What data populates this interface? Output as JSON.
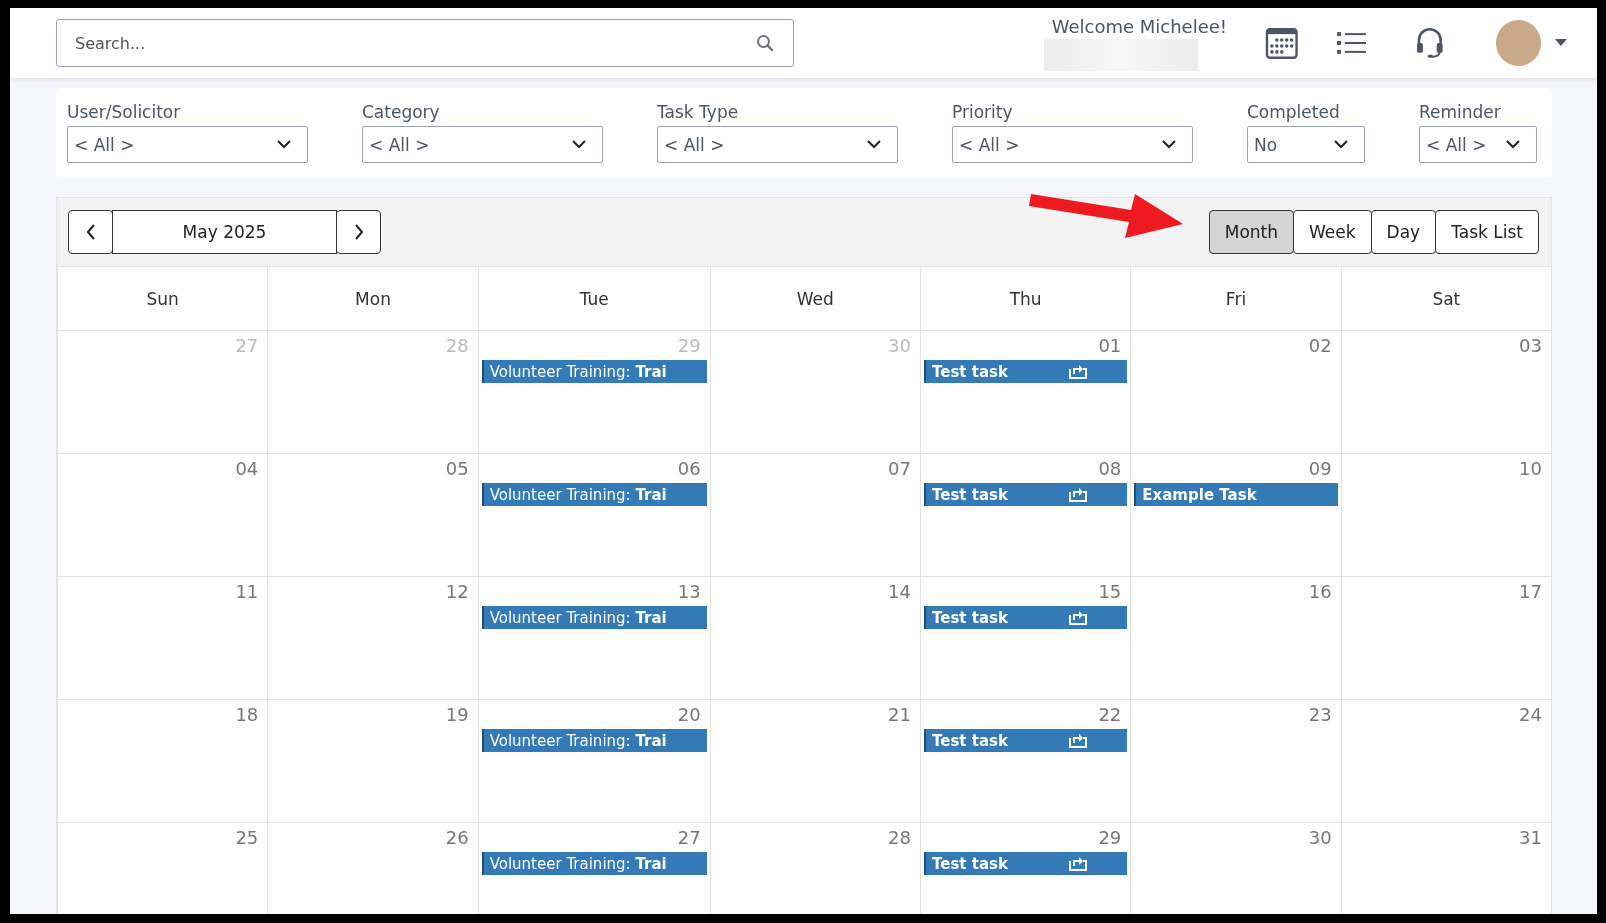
{
  "header": {
    "search": {
      "placeholder": "Search..."
    },
    "welcome": "Welcome Michelee!"
  },
  "filters": [
    {
      "label": "User/Solicitor",
      "value": "< All >"
    },
    {
      "label": "Category",
      "value": "< All >"
    },
    {
      "label": "Task Type",
      "value": "< All >"
    },
    {
      "label": "Priority",
      "value": "< All >"
    },
    {
      "label": "Completed",
      "value": "No"
    },
    {
      "label": "Reminder",
      "value": "< All >"
    }
  ],
  "toolbar": {
    "period": "May 2025",
    "views": [
      {
        "label": "Month",
        "selected": true
      },
      {
        "label": "Week",
        "selected": false
      },
      {
        "label": "Day",
        "selected": false
      },
      {
        "label": "Task List",
        "selected": false
      }
    ]
  },
  "weekdays": [
    "Sun",
    "Mon",
    "Tue",
    "Wed",
    "Thu",
    "Fri",
    "Sat"
  ],
  "weeks": [
    [
      {
        "day": "27",
        "muted": true
      },
      {
        "day": "28",
        "muted": true
      },
      {
        "day": "29",
        "muted": true,
        "events": [
          {
            "kind": "training",
            "text": "Volunteer Training: **Trai**"
          }
        ]
      },
      {
        "day": "30",
        "muted": true
      },
      {
        "day": "01",
        "muted": false,
        "events": [
          {
            "kind": "task",
            "text": "Test task",
            "repeat": true
          }
        ]
      },
      {
        "day": "02",
        "muted": false
      },
      {
        "day": "03",
        "muted": false
      }
    ],
    [
      {
        "day": "04",
        "muted": false
      },
      {
        "day": "05",
        "muted": false
      },
      {
        "day": "06",
        "muted": false,
        "events": [
          {
            "kind": "training",
            "text": "Volunteer Training: **Trai**"
          }
        ]
      },
      {
        "day": "07",
        "muted": false
      },
      {
        "day": "08",
        "muted": false,
        "events": [
          {
            "kind": "task",
            "text": "Test task",
            "repeat": true
          }
        ]
      },
      {
        "day": "09",
        "muted": false,
        "events": [
          {
            "kind": "task",
            "text": "Example Task",
            "repeat": false
          }
        ]
      },
      {
        "day": "10",
        "muted": false
      }
    ],
    [
      {
        "day": "11",
        "muted": false
      },
      {
        "day": "12",
        "muted": false
      },
      {
        "day": "13",
        "muted": false,
        "events": [
          {
            "kind": "training",
            "text": "Volunteer Training: **Trai**"
          }
        ]
      },
      {
        "day": "14",
        "muted": false
      },
      {
        "day": "15",
        "muted": false,
        "events": [
          {
            "kind": "task",
            "text": "Test task",
            "repeat": true
          }
        ]
      },
      {
        "day": "16",
        "muted": false
      },
      {
        "day": "17",
        "muted": false
      }
    ],
    [
      {
        "day": "18",
        "muted": false
      },
      {
        "day": "19",
        "muted": false
      },
      {
        "day": "20",
        "muted": false,
        "events": [
          {
            "kind": "training",
            "text": "Volunteer Training: **Trai**"
          }
        ]
      },
      {
        "day": "21",
        "muted": false
      },
      {
        "day": "22",
        "muted": false,
        "events": [
          {
            "kind": "task",
            "text": "Test task",
            "repeat": true
          }
        ]
      },
      {
        "day": "23",
        "muted": false
      },
      {
        "day": "24",
        "muted": false
      }
    ],
    [
      {
        "day": "25",
        "muted": false
      },
      {
        "day": "26",
        "muted": false
      },
      {
        "day": "27",
        "muted": false,
        "events": [
          {
            "kind": "training",
            "text": "Volunteer Training: **Trai**"
          }
        ]
      },
      {
        "day": "28",
        "muted": false
      },
      {
        "day": "29",
        "muted": false,
        "events": [
          {
            "kind": "task",
            "text": "Test task",
            "repeat": true
          }
        ]
      },
      {
        "day": "30",
        "muted": false
      },
      {
        "day": "31",
        "muted": false
      }
    ]
  ]
}
